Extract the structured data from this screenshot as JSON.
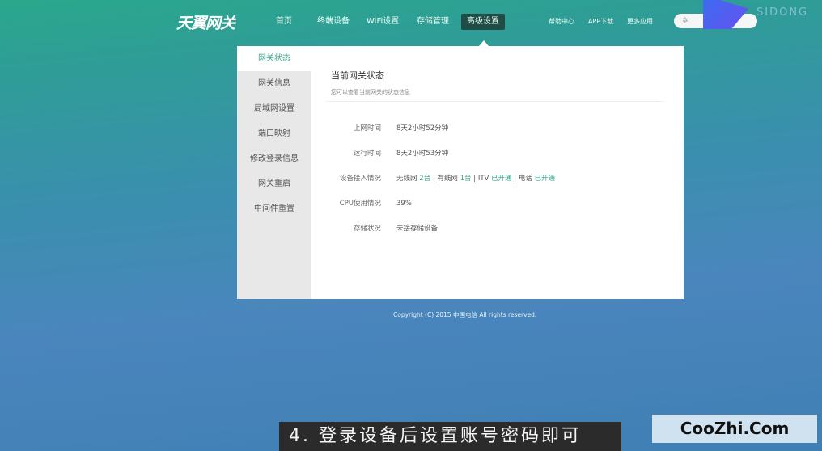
{
  "header": {
    "logo": "天翼网关",
    "nav": [
      "首页",
      "终端设备",
      "WiFi设置",
      "存储管理",
      "高级设置"
    ],
    "active": "高级设置",
    "right": [
      "帮助中心",
      "APP下载",
      "更多应用"
    ],
    "pill": "退出"
  },
  "watermark": "SIDONG",
  "sidebar": {
    "items": [
      "网关状态",
      "网关信息",
      "局域网设置",
      "端口映射",
      "修改登录信息",
      "网关重启",
      "中间件重置"
    ]
  },
  "main": {
    "title": "当前网关状态",
    "subtitle": "您可以查看当前网关的状态信息",
    "rows": [
      {
        "label": "上网时间",
        "value": "8天2小时52分钟"
      },
      {
        "label": "运行时间",
        "value": "8天2小时53分钟"
      },
      {
        "label": "设备接入情况",
        "parts": [
          "无线网",
          "2台",
          " | 有线网",
          "1台",
          " | ITV",
          "已开通",
          " | 电话",
          "已开通"
        ]
      },
      {
        "label": "CPU使用情况",
        "value": "39%"
      },
      {
        "label": "存储状况",
        "value": "未接存储设备"
      }
    ]
  },
  "footer": {
    "copyright": "Copyright (C) 2015 中国电信 All rights reserved."
  },
  "caption": "4. 登录设备后设置账号密码即可",
  "site_badge": "CooZhi.Com",
  "colors": {
    "accent": "#3aa88e",
    "active_nav": "#1f4d46"
  }
}
